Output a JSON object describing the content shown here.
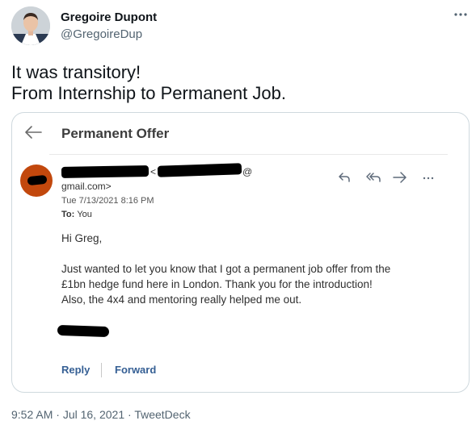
{
  "author": {
    "name": "Gregoire Dupont",
    "handle": "@GregoireDup",
    "avatar_icon": "profile-photo"
  },
  "more_icon": "more-horizontal-icon",
  "tweet_text": {
    "line1": "It was transitory!",
    "line2": "From Internship to Permanent Job."
  },
  "email": {
    "back_icon": "back-arrow-icon",
    "subject": "Permanent Offer",
    "sender_avatar_color": "#c2480d",
    "sender_name_sep_open": "<",
    "sender_at": "@",
    "sender_domain": "gmail.com>",
    "date": "Tue 7/13/2021 8:16 PM",
    "to_label": "To:",
    "to_value": "You",
    "actions": {
      "reply_icon": "reply-icon",
      "reply_all_icon": "reply-all-icon",
      "forward_icon": "forward-icon",
      "more_icon": "more-horizontal-icon"
    },
    "greeting": "Hi Greg,",
    "body_lines": [
      "Just wanted to let you know that I got a permanent job offer from the",
      "£1bn hedge fund here in London. Thank you for the introduction!",
      "Also, the 4x4 and mentoring really helped me out."
    ],
    "reply_label": "Reply",
    "forward_label": "Forward",
    "link_color": "#355f94"
  },
  "meta": {
    "time": "9:52 AM",
    "separator": "·",
    "date": "Jul 16, 2021",
    "source": "TweetDeck"
  }
}
